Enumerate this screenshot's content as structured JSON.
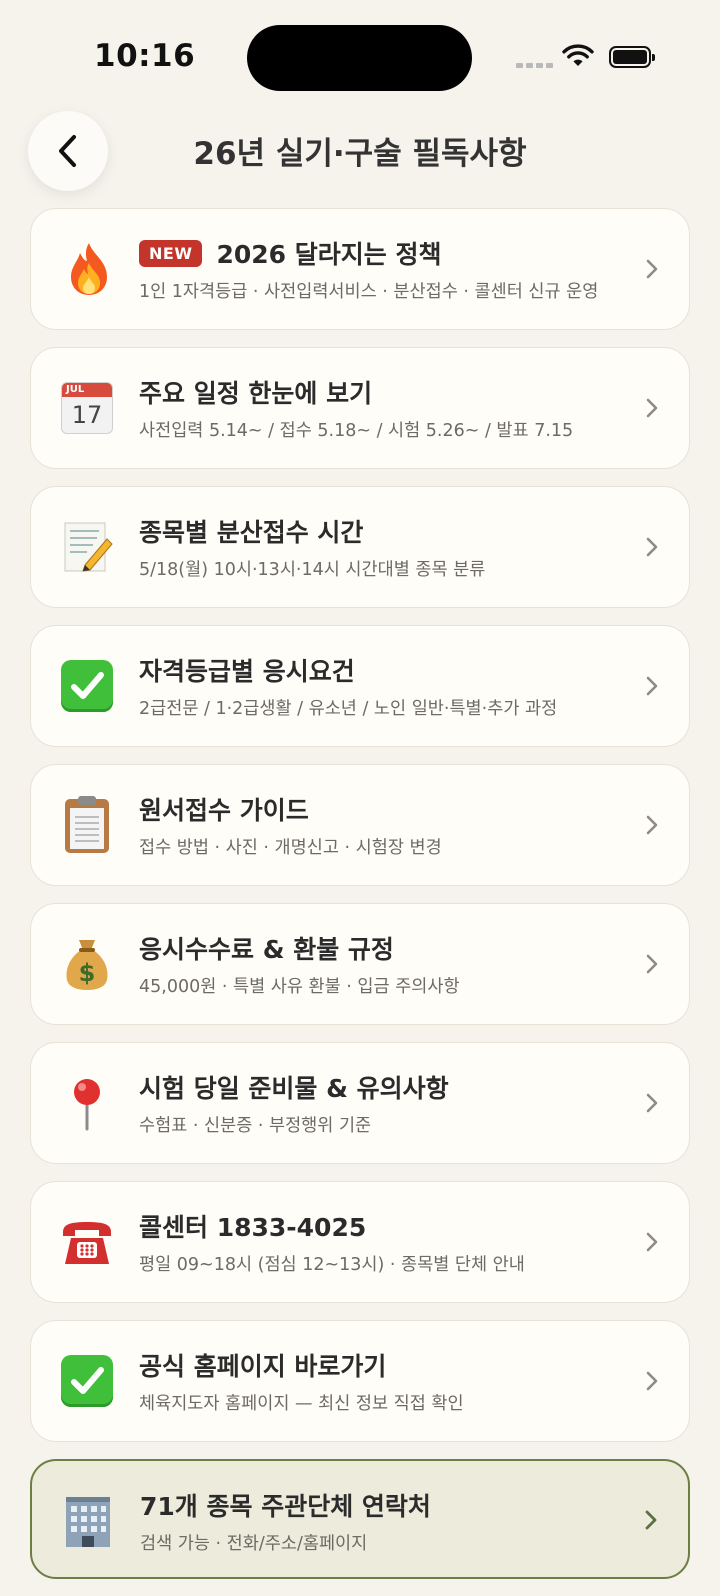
{
  "status_bar": {
    "time": "10:16"
  },
  "header": {
    "title": "26년 실기·구술 필독사항",
    "back_icon": "chevron-left-icon"
  },
  "cards": [
    {
      "icon": "fire-icon",
      "badge": "NEW",
      "title": "2026 달라지는 정책",
      "subtitle": "1인 1자격등급 · 사전입력서비스 · 분산접수 · 콜센터 신규 운영"
    },
    {
      "icon": "calendar-icon",
      "calendar_month": "JUL",
      "calendar_day": "17",
      "title": "주요 일정 한눈에 보기",
      "subtitle": "사전입력 5.14~ / 접수 5.18~ / 시험 5.26~ / 발표 7.15"
    },
    {
      "icon": "memo-icon",
      "title": "종목별 분산접수 시간",
      "subtitle": "5/18(월) 10시·13시·14시 시간대별 종목 분류"
    },
    {
      "icon": "check-mark-icon",
      "title": "자격등급별 응시요건",
      "subtitle": "2급전문 / 1·2급생활 / 유소년 / 노인 일반·특별·추가 과정"
    },
    {
      "icon": "clipboard-icon",
      "title": "원서접수 가이드",
      "subtitle": "접수 방법 · 사진 · 개명신고 · 시험장 변경"
    },
    {
      "icon": "money-bag-icon",
      "title": "응시수수료 & 환불 규정",
      "subtitle": "45,000원 · 특별 사유 환불 · 입금 주의사항"
    },
    {
      "icon": "pushpin-icon",
      "title": "시험 당일 준비물 & 유의사항",
      "subtitle": "수험표 · 신분증 · 부정행위 기준"
    },
    {
      "icon": "telephone-icon",
      "title": "콜센터 1833-4025",
      "subtitle": "평일 09~18시 (점심 12~13시) · 종목별 단체 안내"
    },
    {
      "icon": "check-mark-icon",
      "title": "공식 홈페이지 바로가기",
      "subtitle": "체육지도자 홈페이지 — 최신 정보 직접 확인"
    },
    {
      "icon": "office-building-icon",
      "title": "71개 종목 주관단체 연락처",
      "subtitle": "검색 가능 · 전화/주소/홈페이지"
    }
  ],
  "colors": {
    "background": "#f6f3ec",
    "card": "#fffdf8",
    "badge": "#c3352b",
    "highlight_border": "#6b7e43"
  }
}
